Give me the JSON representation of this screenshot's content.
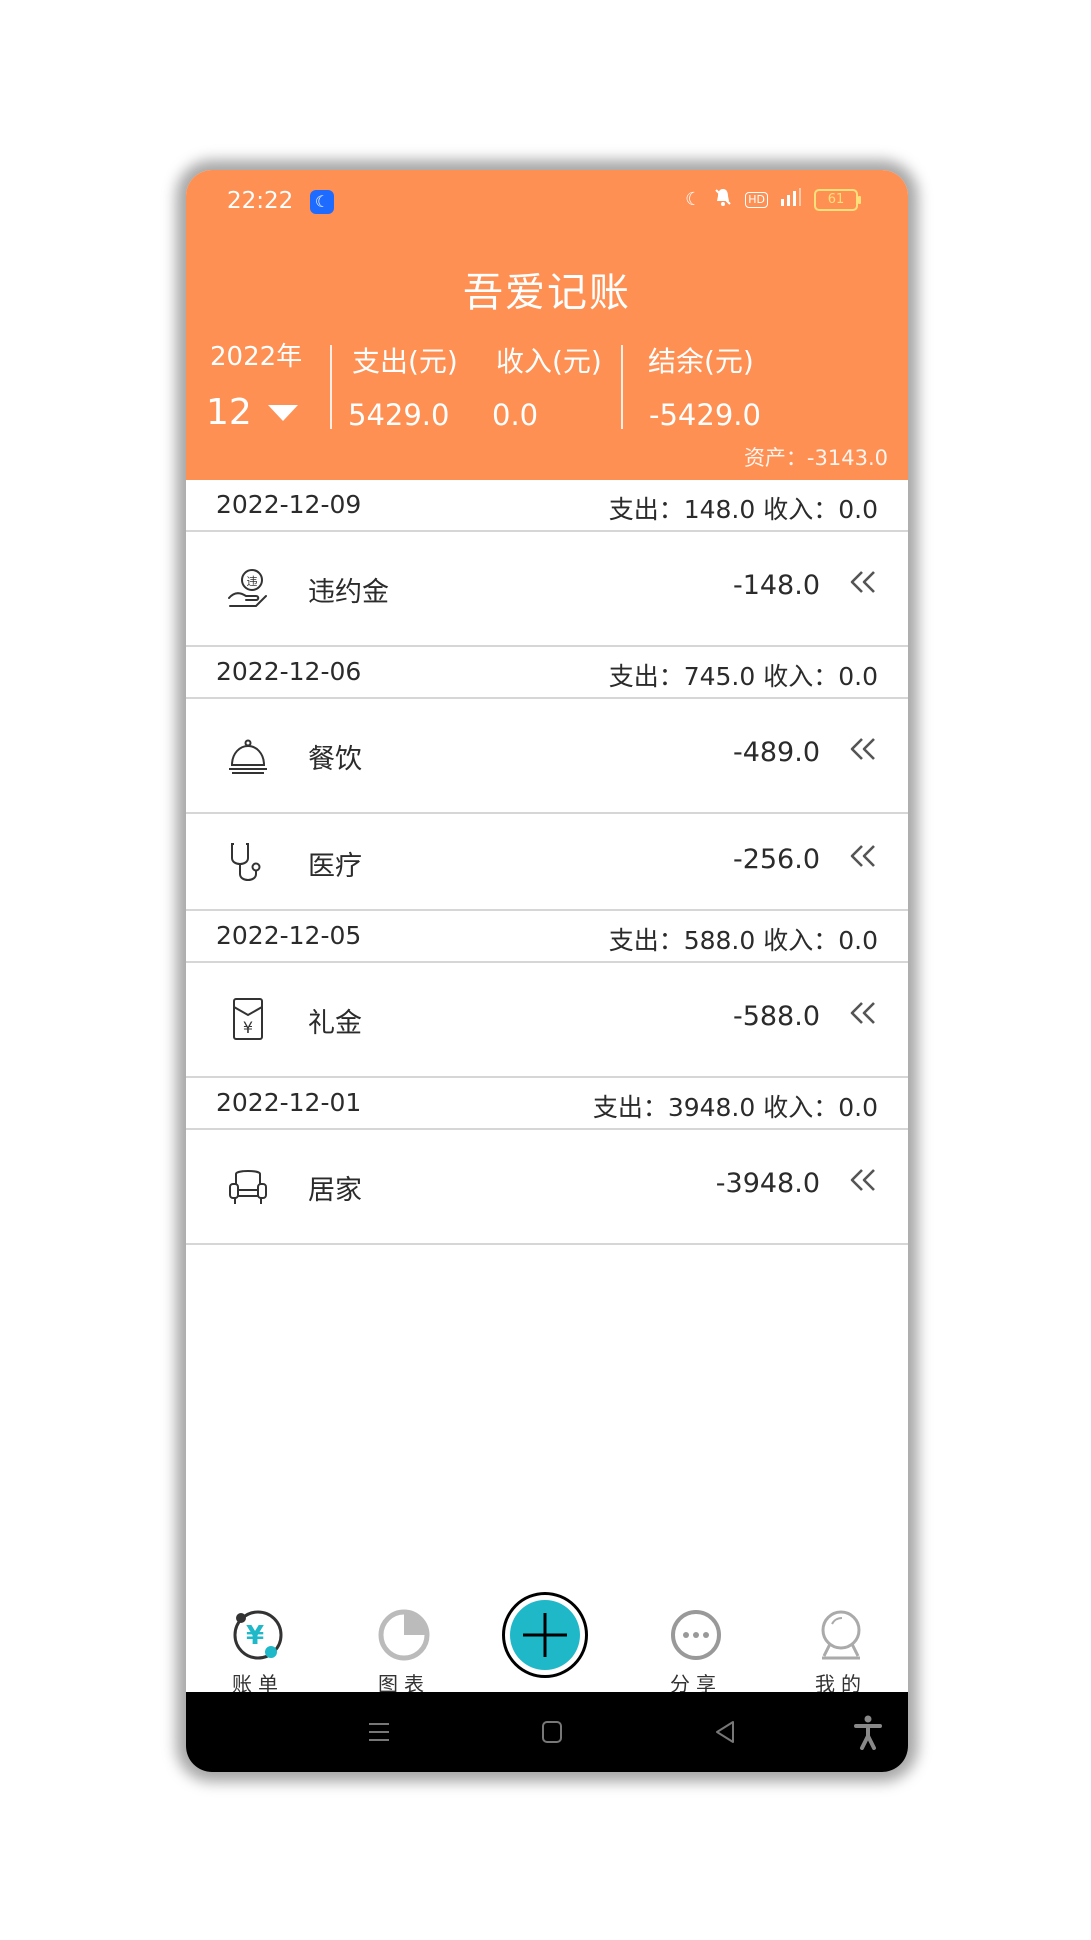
{
  "status_bar": {
    "time": "22:22",
    "battery": "61"
  },
  "header": {
    "title": "吾爱记账",
    "year": "2022年",
    "month": "12",
    "expense_label": "支出(元)",
    "expense_value": "5429.0",
    "income_label": "收入(元)",
    "income_value": "0.0",
    "balance_label": "结余(元)",
    "balance_value": "-5429.0",
    "assets": "资产：-3143.0"
  },
  "days": [
    {
      "date": "2022-12-09",
      "summary": "支出：148.0 收入：0.0",
      "entries": [
        {
          "icon": "breach-hand-icon",
          "category": "违约金",
          "amount": "-148.0"
        }
      ]
    },
    {
      "date": "2022-12-06",
      "summary": "支出：745.0 收入：0.0",
      "entries": [
        {
          "icon": "food-cloche-icon",
          "category": "餐饮",
          "amount": "-489.0"
        },
        {
          "icon": "stethoscope-icon",
          "category": "医疗",
          "amount": "-256.0"
        }
      ]
    },
    {
      "date": "2022-12-05",
      "summary": "支出：588.0 收入：0.0",
      "entries": [
        {
          "icon": "red-envelope-icon",
          "category": "礼金",
          "amount": "-588.0"
        }
      ]
    },
    {
      "date": "2022-12-01",
      "summary": "支出：3948.0 收入：0.0",
      "entries": [
        {
          "icon": "armchair-icon",
          "category": "居家",
          "amount": "-3948.0"
        }
      ]
    }
  ],
  "tabs": {
    "bills": "账单",
    "charts": "图表",
    "share": "分享",
    "mine": "我的"
  },
  "colors": {
    "header": "#FF9053",
    "accent": "#1FB8C8"
  }
}
